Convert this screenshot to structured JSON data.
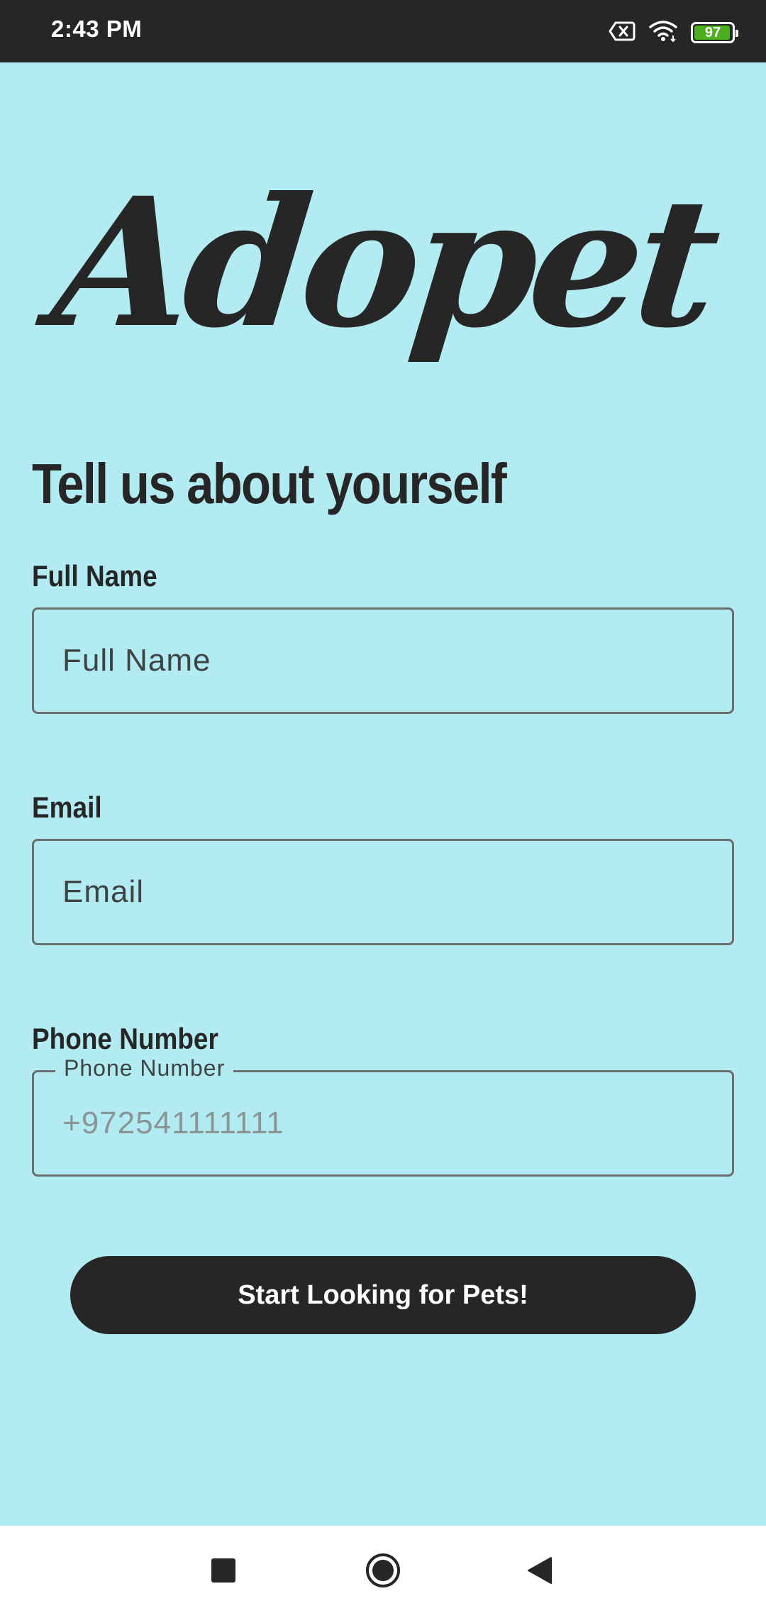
{
  "status_bar": {
    "time": "2:43 PM",
    "battery_level": "97",
    "icons": [
      "no-sim-icon",
      "wifi-icon",
      "battery-icon"
    ]
  },
  "logo": {
    "text": "Adopet"
  },
  "headline": "Tell us about yourself",
  "form": {
    "full_name": {
      "label": "Full Name",
      "placeholder": "Full Name",
      "value": ""
    },
    "email": {
      "label": "Email",
      "placeholder": "Email",
      "value": ""
    },
    "phone": {
      "label": "Phone Number",
      "floating_label": "Phone Number",
      "placeholder": "+972541111111",
      "value": ""
    }
  },
  "cta_button": {
    "label": "Start Looking for Pets!"
  },
  "nav_bar": {
    "buttons": [
      "recents-square-icon",
      "home-circle-icon",
      "back-triangle-icon"
    ]
  },
  "colors": {
    "background": "#B2EBF2",
    "dark": "#262626",
    "battery_green": "#4CAF1F",
    "field_border": "#6b6f70"
  }
}
